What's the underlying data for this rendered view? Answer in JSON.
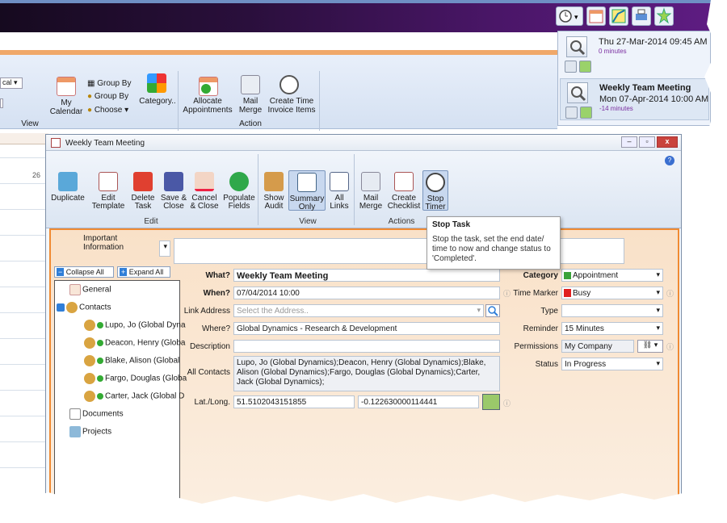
{
  "calendar_ribbon": {
    "view_select": "cal",
    "my_calendar": "My Calendar",
    "group_by_1": "Group By",
    "group_by_2": "Group By",
    "choose": "Choose",
    "category": "Category..",
    "allocate": "Allocate Appointments",
    "mail_merge": "Mail Merge",
    "create_time": "Create Time Invoice Items",
    "group_view": "View",
    "group_action": "Action",
    "day_number": "26"
  },
  "reminders": [
    {
      "date": "Thu 27-Mar-2014 09:45 AM",
      "minutes": "0 minutes"
    },
    {
      "title": "Weekly Team Meeting",
      "date": "Mon 07-Apr-2014 10:00 AM",
      "minutes": "-14 minutes"
    }
  ],
  "dialog": {
    "title": "Weekly Team Meeting",
    "buttons": [
      "Duplicate",
      "Edit Template",
      "Delete Task",
      "Save & Close",
      "Cancel & Close",
      "Populate Fields",
      "Show Audit",
      "Summary Only",
      "All Links",
      "Mail Merge",
      "Create Checklist",
      "Stop Timer"
    ],
    "groups": [
      "Edit",
      "View",
      "Actions"
    ]
  },
  "tooltip": {
    "title": "Stop Task",
    "body": "Stop the task, set the end date/ time to now and change status to 'Completed'."
  },
  "form": {
    "important_label": "Important Information",
    "collapse_all": "Collapse All",
    "expand_all": "Expand All",
    "what_label": "What?",
    "what_value": "Weekly Team Meeting",
    "when_label": "When?",
    "when_value": "07/04/2014 10:00",
    "link_label": "Link Address",
    "link_placeholder": "Select the Address..",
    "where_label": "Where?",
    "where_value": "Global Dynamics - Research & Development",
    "description_label": "Description",
    "contacts_label": "All Contacts",
    "contacts_value": "Lupo, Jo (Global Dynamics);Deacon, Henry (Global Dynamics);Blake, Alison (Global Dynamics);Fargo, Douglas (Global Dynamics);Carter, Jack (Global Dynamics);",
    "latlong_label": "Lat./Long.",
    "lat": "51.5102043151855",
    "long": "-0.122630000114441",
    "category_label": "Category",
    "category_value": "Appointment",
    "time_marker_label": "Time Marker",
    "time_marker_value": "Busy",
    "type_label": "Type",
    "reminder_label": "Reminder",
    "reminder_value": "15 Minutes",
    "permissions_label": "Permissions",
    "permissions_value": "My Company",
    "status_label": "Status",
    "status_value": "In Progress"
  },
  "tree": {
    "general": "General",
    "contacts": "Contacts",
    "c1": "Lupo, Jo (Global Dyna",
    "c2": "Deacon, Henry (Globa",
    "c3": "Blake, Alison (Global",
    "c4": "Fargo, Douglas (Globa",
    "c5": "Carter, Jack (Global D",
    "documents": "Documents",
    "projects": "Projects"
  },
  "colors": {
    "accent_orange": "#f08a32",
    "title_purple": "#4a1668",
    "busy_red": "#e02020",
    "appointment_green": "#3aa33a"
  }
}
